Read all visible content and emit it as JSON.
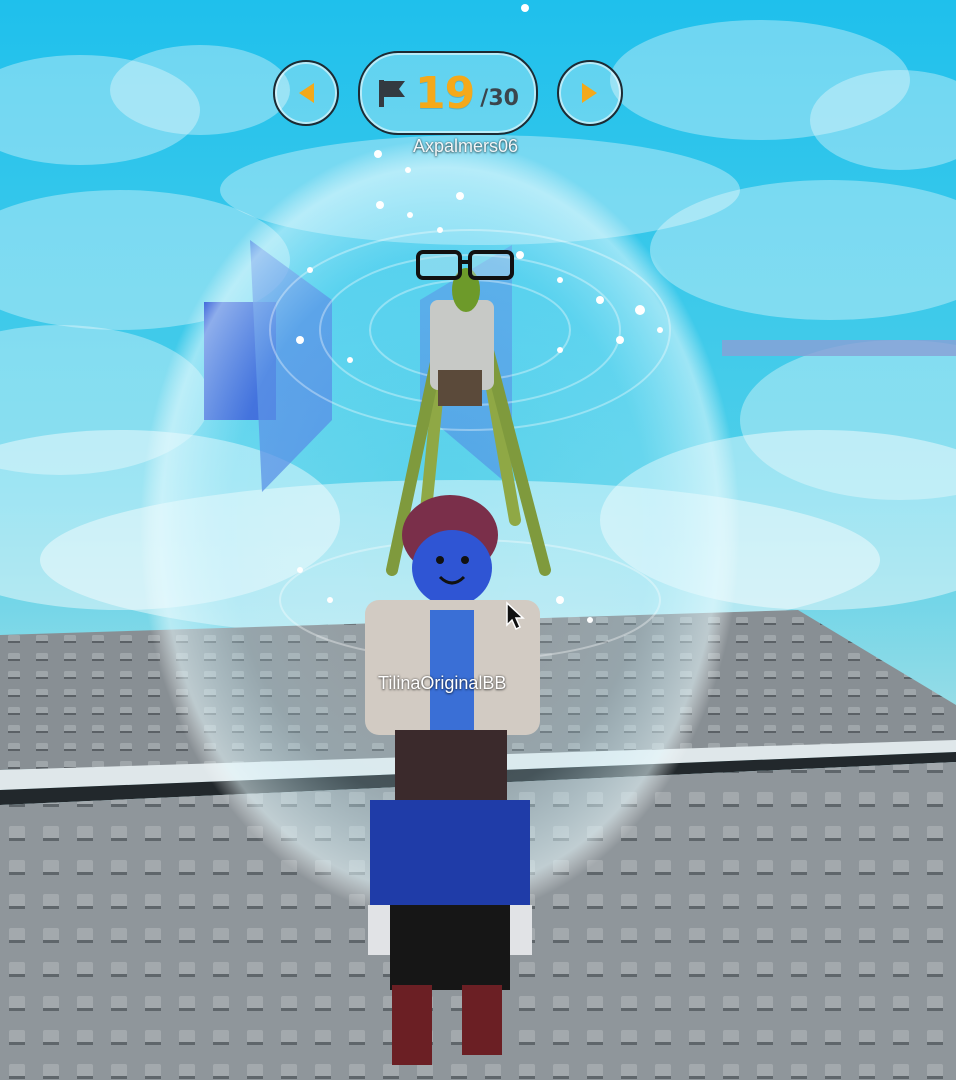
{
  "hud": {
    "stage_current": "19",
    "stage_total": "/30",
    "prev_icon": "arrow-left-icon",
    "next_icon": "arrow-right-icon",
    "stage_icon": "checkpoint-flag-icon"
  },
  "players": {
    "top_name": "Axpalmers06",
    "mid_name": "TilinaOriginalBB"
  },
  "colors": {
    "sky": "#2fc6ea",
    "stage_number": "#f4a91a",
    "baseplate": "#8d9499"
  }
}
